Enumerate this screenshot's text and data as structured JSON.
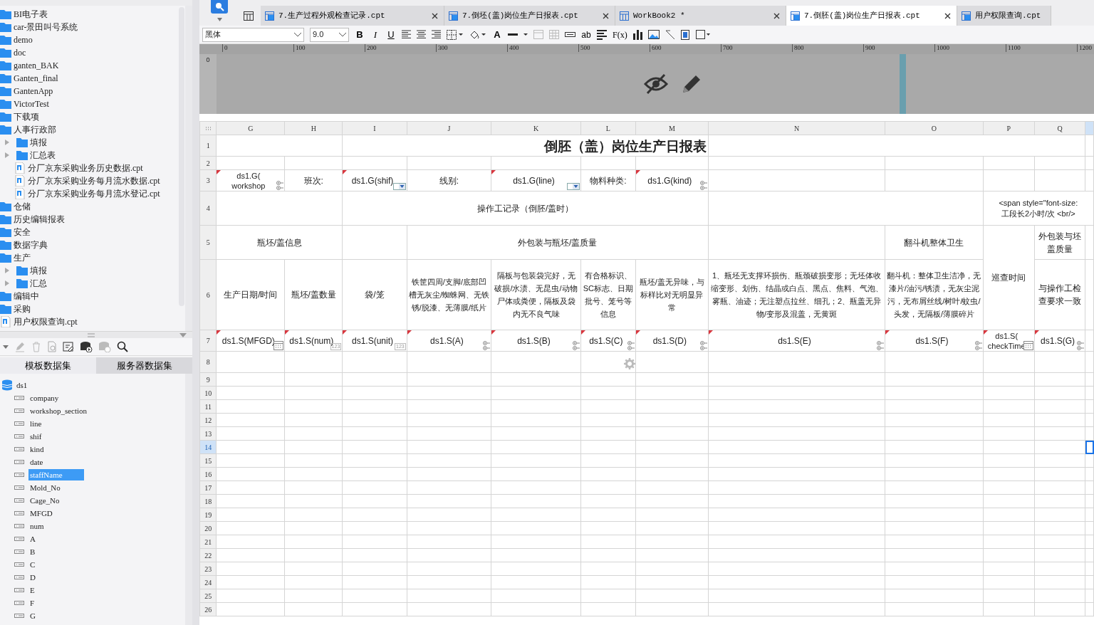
{
  "file_tree": [
    {
      "label": "BI电子表",
      "kind": "folder"
    },
    {
      "label": "car-景田叫号系统",
      "kind": "folder"
    },
    {
      "label": "demo",
      "kind": "folder"
    },
    {
      "label": "doc",
      "kind": "folder"
    },
    {
      "label": "ganten_BAK",
      "kind": "folder"
    },
    {
      "label": "Ganten_final",
      "kind": "folder"
    },
    {
      "label": "GantenApp",
      "kind": "folder"
    },
    {
      "label": "VictorTest",
      "kind": "folder"
    },
    {
      "label": "下载项",
      "kind": "folder"
    },
    {
      "label": "人事行政部",
      "kind": "folder",
      "children": [
        {
          "label": "填报",
          "kind": "folder",
          "expanded": false
        },
        {
          "label": "汇总表",
          "kind": "folder",
          "expanded": false
        },
        {
          "label": "分厂京东采购业务历史数据.cpt",
          "kind": "file"
        },
        {
          "label": "分厂京东采购业务每月流水数据.cpt",
          "kind": "file"
        },
        {
          "label": "分厂京东采购业务每月流水登记.cpt",
          "kind": "file"
        }
      ]
    },
    {
      "label": "仓储",
      "kind": "folder"
    },
    {
      "label": "历史编辑报表",
      "kind": "folder"
    },
    {
      "label": "安全",
      "kind": "folder"
    },
    {
      "label": "数据字典",
      "kind": "folder"
    },
    {
      "label": "生产",
      "kind": "folder",
      "children": [
        {
          "label": "填报",
          "kind": "folder",
          "expanded": false
        },
        {
          "label": "汇总",
          "kind": "folder",
          "expanded": false
        }
      ]
    },
    {
      "label": "编辑中",
      "kind": "folder"
    },
    {
      "label": "采购",
      "kind": "folder"
    },
    {
      "label": "用户权限查询.cpt",
      "kind": "file"
    }
  ],
  "dataset_tabs": [
    {
      "label": "模板数据集",
      "selected": true
    },
    {
      "label": "服务器数据集",
      "selected": false
    }
  ],
  "datasets": [
    {
      "name": "ds1",
      "fields": [
        {
          "name": "company",
          "selected": false
        },
        {
          "name": "workshop_section",
          "selected": false
        },
        {
          "name": "line",
          "selected": false
        },
        {
          "name": "shif",
          "selected": false
        },
        {
          "name": "kind",
          "selected": false
        },
        {
          "name": "date",
          "selected": false
        },
        {
          "name": "staffName",
          "selected": true
        },
        {
          "name": "Mold_No",
          "selected": false
        },
        {
          "name": "Cage_No",
          "selected": false
        },
        {
          "name": "MFGD",
          "selected": false
        },
        {
          "name": "num",
          "selected": false
        },
        {
          "name": "A",
          "selected": false
        },
        {
          "name": "B",
          "selected": false
        },
        {
          "name": "C",
          "selected": false
        },
        {
          "name": "D",
          "selected": false
        },
        {
          "name": "E",
          "selected": false
        },
        {
          "name": "F",
          "selected": false
        },
        {
          "name": "G",
          "selected": false
        }
      ]
    }
  ],
  "doc_tabs": [
    {
      "label": "7.生产过程外观检查记录.cpt",
      "kind": "report",
      "selected": false,
      "closable": true
    },
    {
      "label": "7.倒坯(盖)岗位生产日报表.cpt",
      "kind": "report",
      "selected": false,
      "closable": true
    },
    {
      "label": "WorkBook2 *",
      "kind": "workbook",
      "selected": false,
      "closable": true
    },
    {
      "label": "7.倒胚(盖)岗位生产日报表.cpt",
      "kind": "report",
      "selected": true,
      "closable": true
    },
    {
      "label": "用户权限查询.cpt",
      "kind": "report",
      "selected": false,
      "closable": false
    }
  ],
  "format_toolbar": {
    "font": "黑体",
    "size": "9.0",
    "bold": "B",
    "italic": "I",
    "underline": "U",
    "font_color": "A",
    "text_style": "ab",
    "formula": "F(x)"
  },
  "ruler": {
    "labels": [
      "0",
      "100",
      "200",
      "300",
      "400",
      "500",
      "600",
      "700",
      "800",
      "900",
      "1000",
      "1100",
      "1200"
    ],
    "vertical_label": "0"
  },
  "sheet": {
    "columns": [
      {
        "letter": "G",
        "selected": false
      },
      {
        "letter": "H",
        "selected": false
      },
      {
        "letter": "I",
        "selected": false
      },
      {
        "letter": "J",
        "selected": false
      },
      {
        "letter": "K",
        "selected": false
      },
      {
        "letter": "L",
        "selected": false
      },
      {
        "letter": "M",
        "selected": false
      },
      {
        "letter": "N",
        "selected": false
      },
      {
        "letter": "O",
        "selected": false
      },
      {
        "letter": "P",
        "selected": false
      },
      {
        "letter": "Q",
        "selected": false
      }
    ],
    "trailing_column_selected": true,
    "rows": [
      {
        "number": "1",
        "selected": false,
        "cells": [
          {
            "kind": "blank"
          },
          {
            "kind": "title",
            "text": "倒胚（盖）岗位生产日报表"
          },
          {
            "kind": "blank"
          }
        ]
      },
      {
        "number": "2",
        "selected": false,
        "cells": [
          {
            "kind": "blank"
          },
          {
            "kind": "blank"
          },
          {
            "kind": "blank"
          },
          {
            "kind": "blank"
          },
          {
            "kind": "blank"
          },
          {
            "kind": "blank"
          },
          {
            "kind": "blank"
          },
          {
            "kind": "blank"
          },
          {
            "kind": "blank"
          },
          {
            "kind": "blank"
          },
          {
            "kind": "blank"
          }
        ]
      },
      {
        "number": "3",
        "selected": false,
        "cells": [
          {
            "kind": "expand",
            "text": "ds1.G(\nworkshop"
          },
          {
            "kind": "label",
            "text": "班次:"
          },
          {
            "kind": "dropdown",
            "text": "ds1.G(shif)"
          },
          {
            "kind": "label",
            "text": "线别:"
          },
          {
            "kind": "dropdown",
            "text": "ds1.G(line)"
          },
          {
            "kind": "label",
            "text": "物料种类:"
          },
          {
            "kind": "expand",
            "text": "ds1.G(kind)"
          },
          {
            "kind": "blank"
          },
          {
            "kind": "blank"
          },
          {
            "kind": "blank"
          },
          {
            "kind": "blank"
          }
        ]
      },
      {
        "number": "4",
        "selected": false,
        "cells": [
          {
            "kind": "blank"
          },
          {
            "kind": "label",
            "text": "操作工记录（倒胚/盖时）"
          },
          {
            "kind": "blank"
          },
          {
            "kind": "label",
            "text": "<span style=\"font-size:\n工段长2小时/次 <br/>"
          }
        ]
      },
      {
        "number": "5",
        "selected": false,
        "cells": [
          {
            "kind": "label",
            "text": "瓶坯/盖信息"
          },
          {
            "kind": "blank"
          },
          {
            "kind": "label",
            "text": "外包装与瓶坯/盖质量"
          },
          {
            "kind": "blank"
          },
          {
            "kind": "label",
            "text": "翻斗机整体卫生"
          },
          {
            "kind": "label",
            "text": "巡查时间"
          },
          {
            "kind": "label",
            "text": "外包装与坯盖质量"
          },
          {
            "kind": "blank"
          }
        ]
      },
      {
        "number": "6",
        "selected": false,
        "cells": [
          {
            "kind": "label",
            "text": "生产日期/时间"
          },
          {
            "kind": "label",
            "text": "瓶坯/盖数量"
          },
          {
            "kind": "label",
            "text": "袋/笼"
          },
          {
            "kind": "label",
            "text": "铁筐四周/支脚/底部凹槽无灰尘/蜘蛛网、无铁锈/脱漆、无薄膜/纸片"
          },
          {
            "kind": "label",
            "text": "隔板与包装袋完好，无破损/水渍、无昆虫/动物尸体或粪便，隔板及袋内无不良气味"
          },
          {
            "kind": "label",
            "text": "有合格标识、SC标志、日期批号、笼号等信息"
          },
          {
            "kind": "label",
            "text": "瓶坯/盖无异味，与标样比对无明显异常"
          },
          {
            "kind": "label",
            "text": "1、瓶坯无支撑环损伤、瓶颈破损变形；无坯体收缩变形、划伤、结晶或白点、黑点、焦料、气泡、雾瓶、油迹；无注塑点拉丝、细孔；2、瓶盖无异物/变形及混盖，无黄斑"
          },
          {
            "kind": "label",
            "text": "翻斗机：整体卫生洁净，无漆片/油污/锈渍，无灰尘泥污，无布屑丝线/树叶/蚊虫/头发，无隔板/薄膜碎片"
          },
          {
            "kind": "label",
            "text": "与操作工检查要求一致"
          },
          {
            "kind": "blank"
          }
        ]
      },
      {
        "number": "7",
        "selected": false,
        "cells": [
          {
            "kind": "date",
            "text": "ds1.S(MFGD)"
          },
          {
            "kind": "number",
            "text": "ds1.S(num)",
            "widget_label": "123"
          },
          {
            "kind": "number",
            "text": "ds1.S(unit)",
            "widget_label": "123"
          },
          {
            "kind": "expand",
            "text": "ds1.S(A)"
          },
          {
            "kind": "expand",
            "text": "ds1.S(B)"
          },
          {
            "kind": "expand",
            "text": "ds1.S(C)"
          },
          {
            "kind": "expand",
            "text": "ds1.S(D)"
          },
          {
            "kind": "expand",
            "text": "ds1.S(E)"
          },
          {
            "kind": "expand",
            "text": "ds1.S(F)"
          },
          {
            "kind": "date",
            "text": "ds1.S(\ncheckTime"
          },
          {
            "kind": "expand",
            "text": "ds1.S(G)"
          },
          {
            "kind": "blank"
          }
        ]
      },
      {
        "number": "8",
        "selected": false,
        "cells": [
          {
            "kind": "blank"
          },
          {
            "kind": "blank"
          },
          {
            "kind": "blank"
          },
          {
            "kind": "blank"
          },
          {
            "kind": "blank"
          },
          {
            "kind": "loading"
          },
          {
            "kind": "blank"
          },
          {
            "kind": "blank"
          },
          {
            "kind": "blank"
          },
          {
            "kind": "blank"
          },
          {
            "kind": "blank"
          }
        ]
      },
      {
        "number": "9",
        "selected": false
      },
      {
        "number": "10",
        "selected": false
      },
      {
        "number": "11",
        "selected": false
      },
      {
        "number": "12",
        "selected": false
      },
      {
        "number": "13",
        "selected": false
      },
      {
        "number": "14",
        "selected": true
      },
      {
        "number": "15",
        "selected": false
      },
      {
        "number": "16",
        "selected": false
      },
      {
        "number": "17",
        "selected": false
      },
      {
        "number": "18",
        "selected": false
      },
      {
        "number": "19",
        "selected": false
      },
      {
        "number": "20",
        "selected": false
      },
      {
        "number": "21",
        "selected": false
      },
      {
        "number": "22",
        "selected": false
      },
      {
        "number": "23",
        "selected": false
      },
      {
        "number": "24",
        "selected": false
      },
      {
        "number": "25",
        "selected": false
      },
      {
        "number": "26",
        "selected": false
      }
    ]
  }
}
